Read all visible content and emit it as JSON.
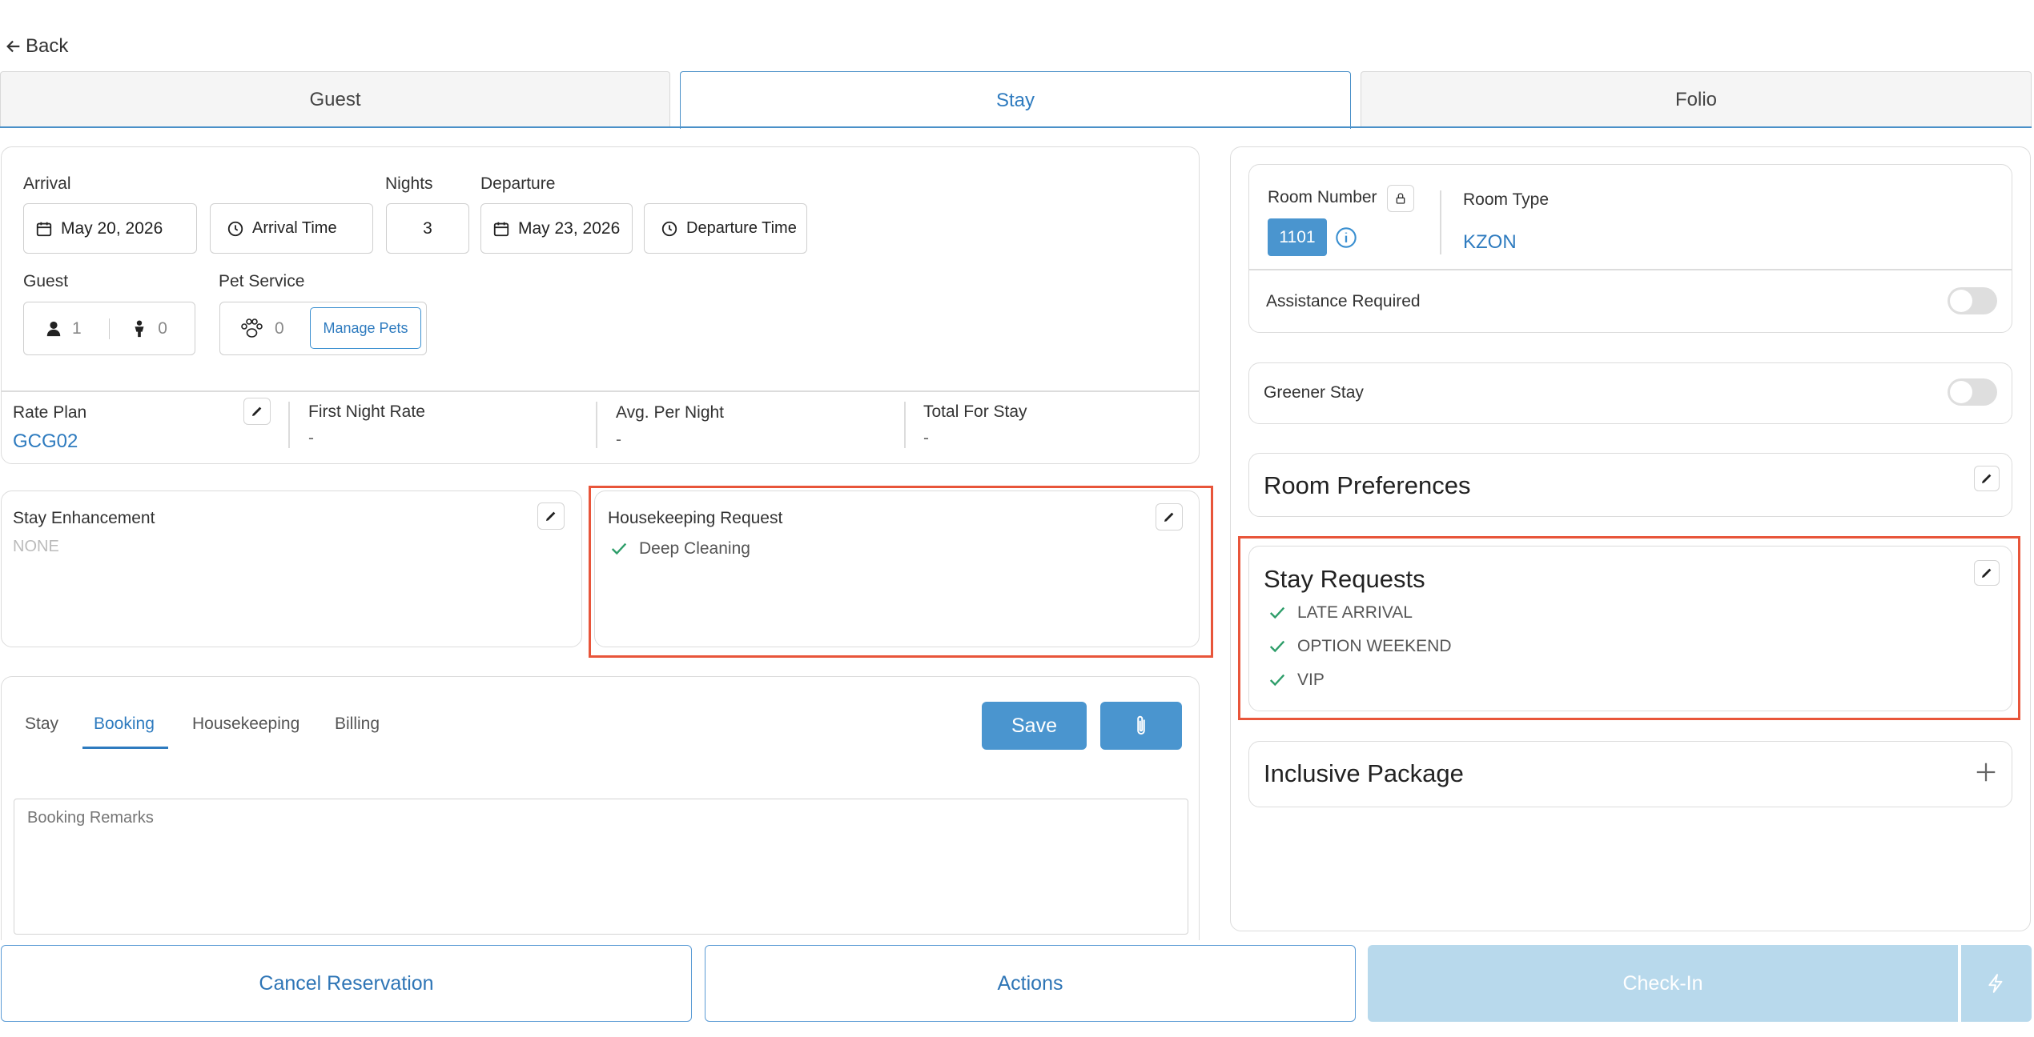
{
  "nav": {
    "back_label": "Back"
  },
  "tabs": [
    {
      "label": "Guest"
    },
    {
      "label": "Stay"
    },
    {
      "label": "Folio"
    }
  ],
  "dates": {
    "arrival_label": "Arrival",
    "arrival_value": "May 20, 2026",
    "arrival_time_label": "Arrival Time",
    "nights_label": "Nights",
    "nights_value": "3",
    "departure_label": "Departure",
    "departure_value": "May 23, 2026",
    "departure_time_label": "Departure Time"
  },
  "guest": {
    "label": "Guest",
    "adults": "1",
    "children": "0"
  },
  "pet_service": {
    "label": "Pet Service",
    "count": "0",
    "manage_label": "Manage Pets"
  },
  "rates": {
    "rate_plan_label": "Rate Plan",
    "rate_plan_value": "GCG02",
    "first_night_label": "First Night Rate",
    "first_night_value": "-",
    "avg_label": "Avg. Per Night",
    "avg_value": "-",
    "total_label": "Total For Stay",
    "total_value": "-"
  },
  "stay_enhancement": {
    "title": "Stay Enhancement",
    "value": "NONE"
  },
  "housekeeping_request": {
    "title": "Housekeeping Request",
    "items": [
      "Deep Cleaning"
    ]
  },
  "remarks": {
    "tabs": [
      "Stay",
      "Booking",
      "Housekeeping",
      "Billing"
    ],
    "active_tab": "Booking",
    "save_label": "Save",
    "placeholder": "Booking Remarks"
  },
  "room": {
    "number_label": "Room Number",
    "number_value": "1101",
    "type_label": "Room Type",
    "type_value": "KZON",
    "assistance_label": "Assistance Required",
    "assistance_on": false
  },
  "greener_stay": {
    "label": "Greener Stay",
    "on": false
  },
  "room_preferences": {
    "title": "Room Preferences"
  },
  "stay_requests": {
    "title": "Stay Requests",
    "items": [
      "LATE ARRIVAL",
      "OPTION WEEKEND",
      "VIP"
    ]
  },
  "inclusive_package": {
    "title": "Inclusive Package"
  },
  "footer": {
    "cancel_label": "Cancel Reservation",
    "actions_label": "Actions",
    "checkin_label": "Check-In"
  },
  "colors": {
    "accent": "#3a8fd0",
    "check_green": "#2e9e6a",
    "highlight_red": "#e8553a",
    "disabled_blue": "#b8d9ec"
  }
}
